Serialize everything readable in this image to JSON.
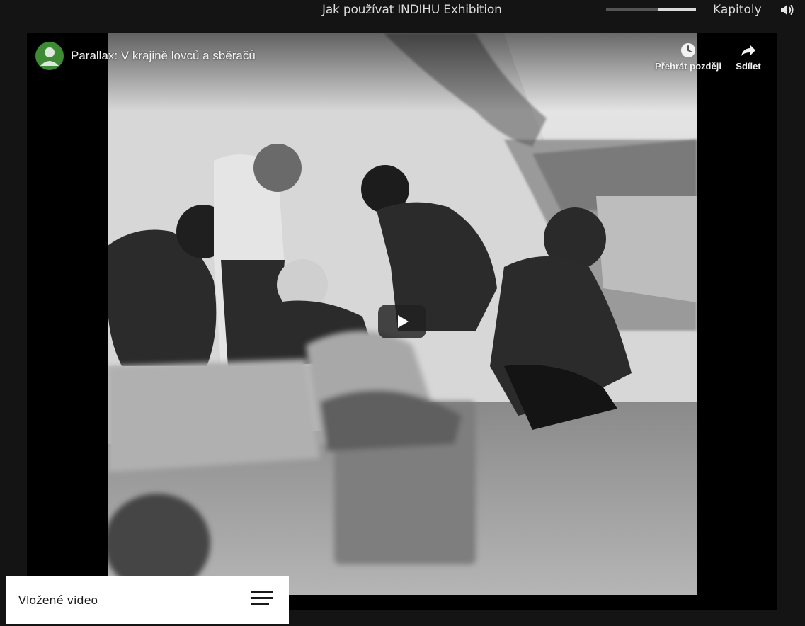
{
  "header": {
    "title": "Jak používat INDIHU Exhibition",
    "progress_fraction": 0.42,
    "chapters_label": "Kapitoly",
    "sound_icon": "speaker-icon"
  },
  "video": {
    "title": "Parallax: V krajině lovců a sběračů",
    "watch_later_label": "Přehrát později",
    "share_label": "Sdílet",
    "play_icon": "play-icon",
    "photo_description_icon": "archaeological-excavation-photo"
  },
  "caption": {
    "text": "Vložené video",
    "menu_icon": "hamburger-menu-icon"
  },
  "colors": {
    "background": "#141414",
    "avatar": "#3f8a35",
    "text_light": "#dcdcdc"
  }
}
